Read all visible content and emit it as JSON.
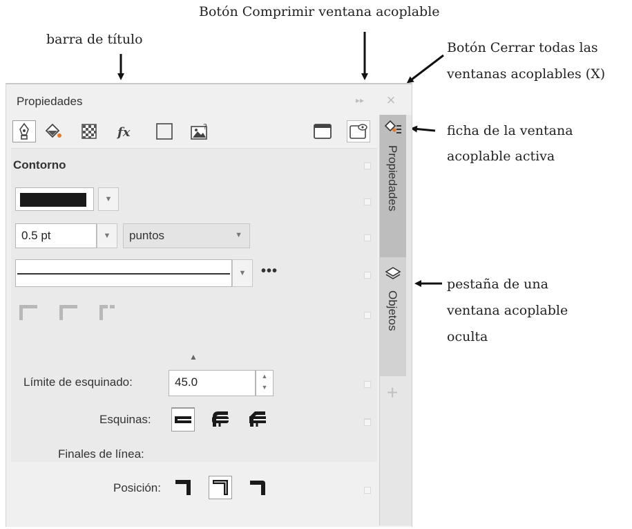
{
  "annotations": {
    "title_bar": "barra de título",
    "collapse_button": "Botón Comprimir ventana acoplable",
    "close_button_line1": "Botón Cerrar todas las",
    "close_button_line2": "ventanas acoplables (X)",
    "active_tab_line1": "ficha de la ventana",
    "active_tab_line2": "acoplable activa",
    "hidden_tab_line1": "pestaña de una",
    "hidden_tab_line2": "ventana acoplable",
    "hidden_tab_line3": "oculta"
  },
  "docker": {
    "title": "Propiedades",
    "collapse_glyph": "▸▸",
    "close_glyph": "×",
    "section_heading": "Contorno",
    "width_value": "0.5 pt",
    "units_value": "puntos",
    "more_glyph": "•••",
    "miter_label": "Límite de esquinado:",
    "miter_value": "45.0",
    "corners_label": "Esquinas:",
    "line_caps_label": "Finales de línea:",
    "position_label": "Posición:",
    "collapse_arrow": "▲"
  },
  "tabs": {
    "active": "Propiedades",
    "hidden": "Objetos",
    "add_glyph": "+"
  },
  "colors": {
    "outline_color": "#1a1a1a",
    "panel_bg": "#f0f0f0",
    "active_tab": "#bdbdbd"
  }
}
